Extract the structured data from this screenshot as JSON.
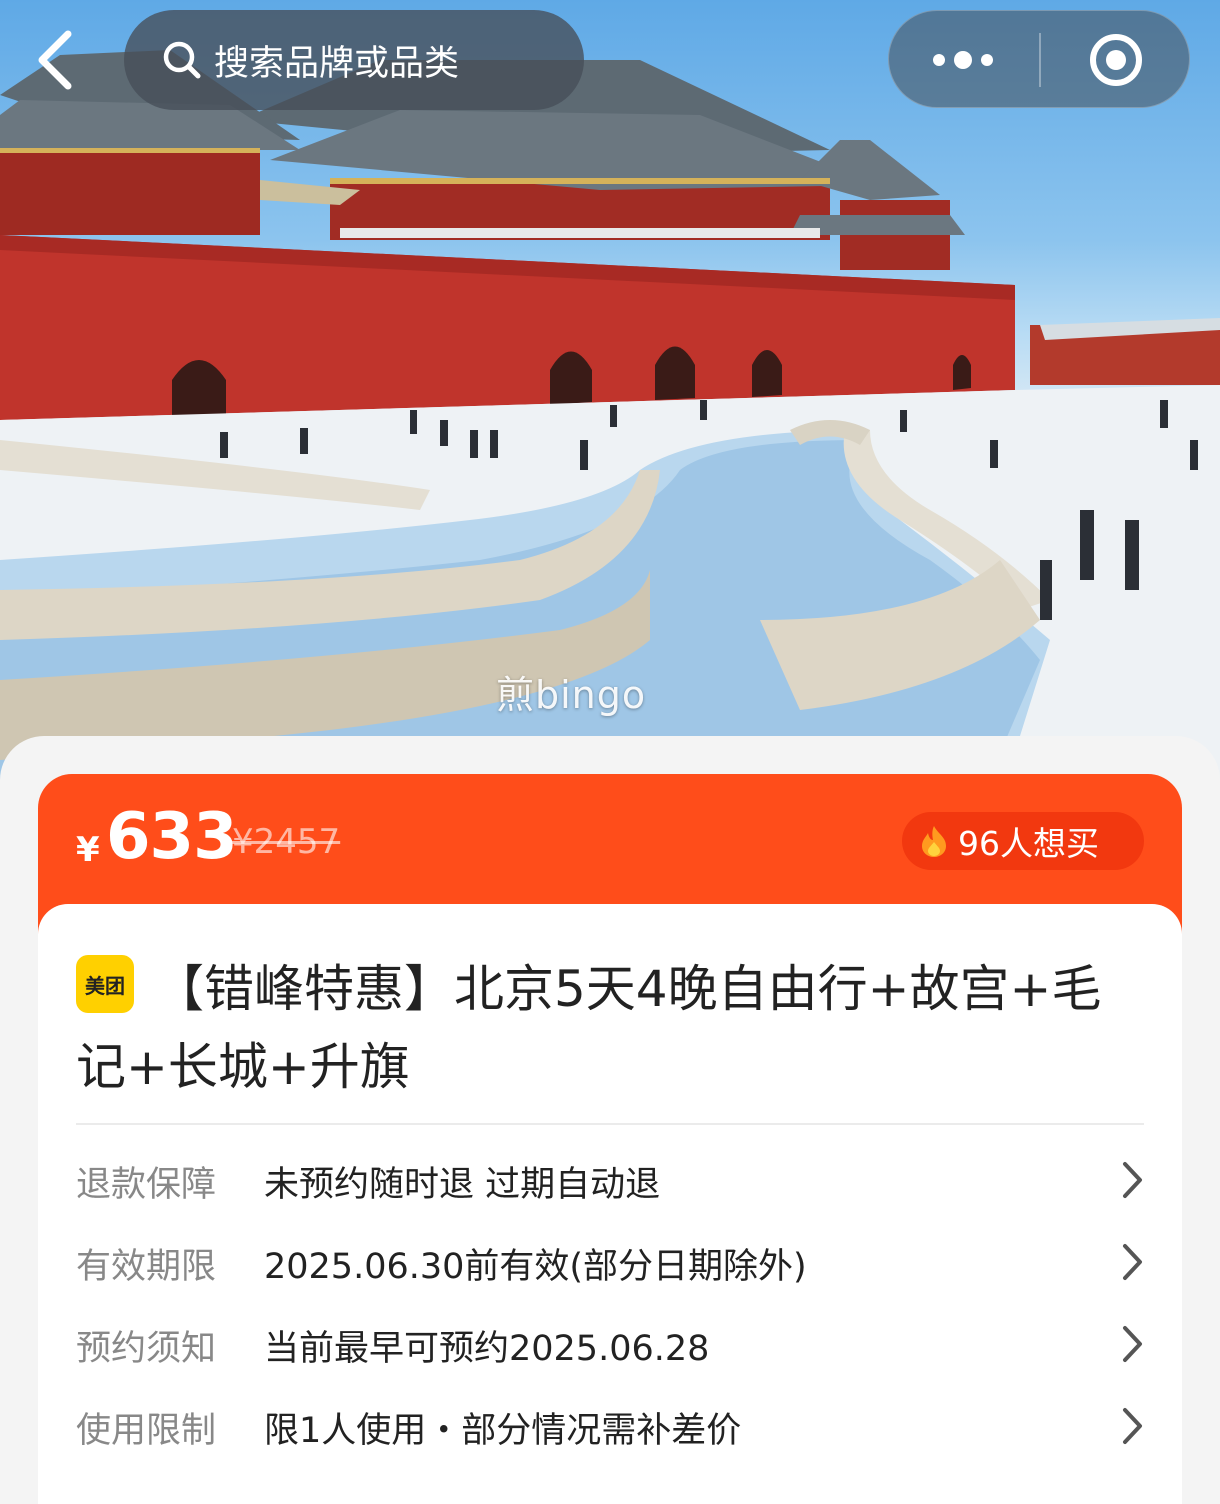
{
  "topbar": {
    "search_placeholder": "搜索品牌或品类"
  },
  "hero": {
    "watermark": "煎bingo"
  },
  "price": {
    "currency": "¥",
    "current": "633",
    "original": "¥2457",
    "want_count": "96人想买"
  },
  "product": {
    "brand_logo_text": "美团",
    "title": "【错峰特惠】北京5天4晚自由行+故宫+毛记+长城+升旗"
  },
  "info": {
    "rows": [
      {
        "label": "退款保障",
        "value": "未预约随时退 过期自动退"
      },
      {
        "label": "有效期限",
        "value": "2025.06.30前有效(部分日期除外)"
      },
      {
        "label": "预约须知",
        "value": "当前最早可预约2025.06.28"
      },
      {
        "label": "使用限制",
        "value": "限1人使用・部分情况需补差价"
      }
    ]
  },
  "colors": {
    "accent": "#ff4d1a",
    "brand_yellow": "#ffd000"
  }
}
